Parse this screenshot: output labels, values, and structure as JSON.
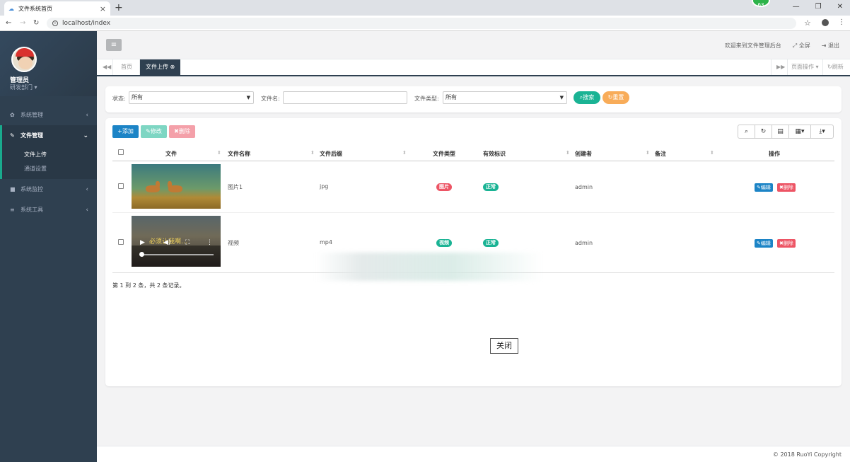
{
  "browser": {
    "tab_title": "文件系统首页",
    "url": "localhost/index",
    "ext_badge": "63"
  },
  "sidebar": {
    "user_name": "管理员",
    "user_dept": "研发部门 ▾",
    "menu": [
      {
        "label": "系统管理",
        "icon": "gear-icon"
      },
      {
        "label": "文件管理",
        "icon": "edit-icon"
      },
      {
        "label": "系统监控",
        "icon": "video-icon"
      },
      {
        "label": "系统工具",
        "icon": "bars-icon"
      }
    ],
    "submenu": [
      "文件上传",
      "通道设置"
    ]
  },
  "header": {
    "welcome": "欢迎来到文件管理后台",
    "fullscreen": "全屏",
    "logout": "退出"
  },
  "tabs": {
    "home": "首页",
    "current": "文件上传",
    "page_ops": "页面操作 ▾",
    "refresh": "刷新"
  },
  "search": {
    "status_label": "状态:",
    "status_value": "所有",
    "filename_label": "文件名:",
    "filename_value": "",
    "filetype_label": "文件类型:",
    "filetype_value": "所有",
    "search_btn": "搜索",
    "reset_btn": "重置"
  },
  "toolbar": {
    "add": "添加",
    "edit": "修改",
    "delete": "删除"
  },
  "table": {
    "headers": [
      "文件",
      "文件名称",
      "文件后缀",
      "文件类型",
      "有效标识",
      "创建者",
      "备注",
      "操作"
    ],
    "rows": [
      {
        "name": "图片1",
        "suffix": "jpg",
        "type": "图片",
        "flag": "正常",
        "creator": "admin",
        "remark": "",
        "edit": "编辑",
        "delete": "删除"
      },
      {
        "name": "视频",
        "suffix": "mp4",
        "type": "视频",
        "flag": "正常",
        "creator": "admin",
        "remark": "",
        "edit": "编辑",
        "delete": "删除",
        "video_text": "必须让我啊…"
      }
    ],
    "pagination": "第 1 到 2 条，共 2 条记录。"
  },
  "close_btn": "关闭",
  "footer": "© 2018 RuoYi Copyright",
  "colors": {
    "sidebar": "#2f4050",
    "accent": "#19aa8d",
    "primary": "#1c84c6",
    "danger": "#ed5565",
    "warning": "#f8ac59",
    "success": "#1ab394"
  }
}
